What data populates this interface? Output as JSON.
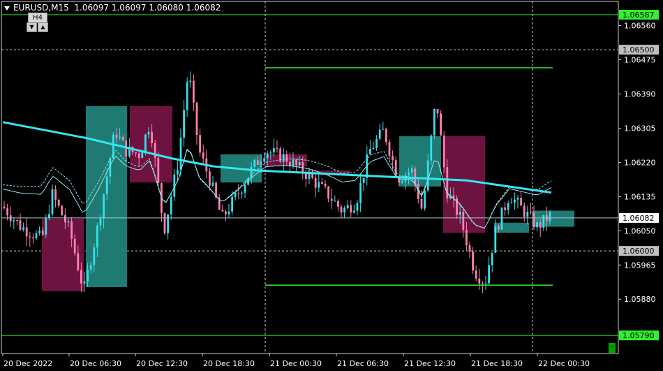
{
  "header": {
    "symbol_tf": "EURUSD,M15",
    "ohlc": "1.06097 1.06097 1.06080 1.06082"
  },
  "tf_widget": {
    "label": "H4",
    "down": "▼",
    "up": "▲"
  },
  "corner_button": "-",
  "colors": {
    "background": "#000000",
    "bull_candle": "#33e0e8",
    "bear_candle": "#ff7fb0",
    "h4_bull_box": "#1f7a73",
    "h4_bear_box": "#6e1340",
    "ma_thick": "#33e8f0",
    "level_line": "#33ee33",
    "price_line": "#a8c8c8"
  },
  "chart_data": {
    "type": "candlestick",
    "symbol": "EURUSD",
    "timeframe": "M15",
    "ylim": [
      1.05745,
      1.0662
    ],
    "yticks": [
      "1.06560",
      "1.06475",
      "1.06390",
      "1.06305",
      "1.06220",
      "1.06135",
      "1.06050",
      "1.05965",
      "1.05880"
    ],
    "xticks": [
      "20 Dec 2022",
      "20 Dec 06:30",
      "20 Dec 12:30",
      "20 Dec 18:30",
      "21 Dec 00:30",
      "21 Dec 06:30",
      "21 Dec 12:30",
      "21 Dec 18:30",
      "22 Dec 00:30"
    ],
    "price_labels": [
      {
        "value": "1.06587",
        "style": "green"
      },
      {
        "value": "1.06500",
        "style": "grey"
      },
      {
        "value": "1.06082",
        "style": "white"
      },
      {
        "value": "1.06000",
        "style": "grey"
      },
      {
        "value": "1.05790",
        "style": "green"
      }
    ],
    "horizontal_levels": [
      {
        "price": 1.06587,
        "from": "20 Dec 2022",
        "to": "end"
      },
      {
        "price": 1.0579,
        "from": "20 Dec 2022",
        "to": "end"
      },
      {
        "price": 1.06455,
        "from": "21 Dec 00:30",
        "to": "22 Dec 00:30"
      },
      {
        "price": 1.05915,
        "from": "21 Dec 00:30",
        "to": "22 Dec 00:30"
      }
    ],
    "dotted_levels": [
      1.065,
      1.06
    ],
    "vertical_separators": [
      "21 Dec 00:00",
      "22 Dec 00:00"
    ],
    "h4_boxes": [
      {
        "open": 1.0608,
        "close": 1.059,
        "high": 1.0608,
        "low": 1.059,
        "dir": "bear"
      },
      {
        "open": 1.0591,
        "close": 1.0636,
        "high": 1.0636,
        "low": 1.0591,
        "dir": "bull"
      },
      {
        "open": 1.0636,
        "close": 1.0617,
        "high": 1.0636,
        "low": 1.0617,
        "dir": "bear"
      },
      {
        "open": 1.0617,
        "close": 1.0624,
        "high": 1.0624,
        "low": 1.0617,
        "dir": "bull"
      },
      {
        "open": 1.0624,
        "close": 1.0621,
        "high": 1.0624,
        "low": 1.0621,
        "dir": "bear"
      },
      {
        "open": 1.062,
        "close": 1.0619,
        "high": 1.062,
        "low": 1.0619,
        "dir": "bear"
      },
      {
        "open": 1.0616,
        "close": 1.06285,
        "high": 1.06285,
        "low": 1.0616,
        "dir": "bull"
      },
      {
        "open": 1.06285,
        "close": 1.06045,
        "high": 1.06285,
        "low": 1.06045,
        "dir": "bear"
      },
      {
        "open": 1.06045,
        "close": 1.0607,
        "high": 1.0607,
        "low": 1.06045,
        "dir": "bull"
      },
      {
        "open": 1.0606,
        "close": 1.061,
        "high": 1.061,
        "low": 1.0606,
        "dir": "bull"
      }
    ],
    "ma_thick": [
      1.0632,
      1.063,
      1.0628,
      1.06255,
      1.0623,
      1.0621,
      1.062,
      1.06195,
      1.0619,
      1.06185,
      1.0618,
      1.06175,
      1.0616,
      1.06145
    ],
    "last_price": 1.06082
  }
}
